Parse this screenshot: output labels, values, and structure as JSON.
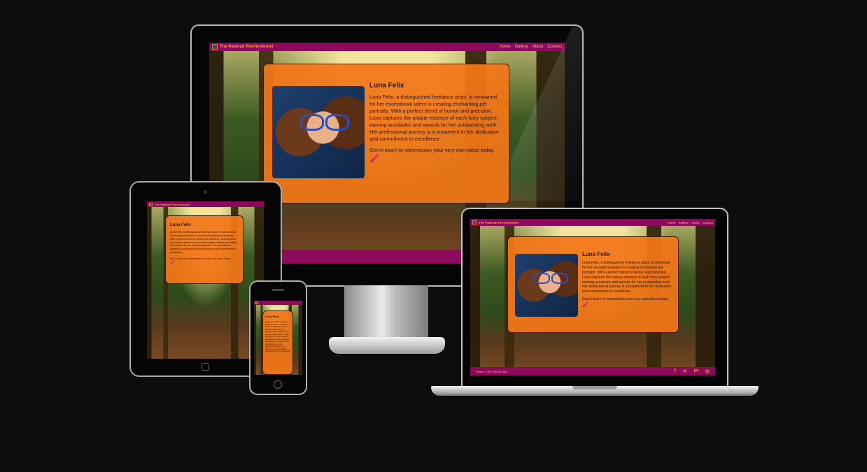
{
  "site": {
    "brand": "The Pawtrait Purrfectionist",
    "nav": [
      "Home",
      "Gallery",
      "About",
      "Contact"
    ],
    "nav_laptop": [
      "Home",
      "Gallery",
      "About",
      "Contact"
    ]
  },
  "about": {
    "heading": "Luna Felix",
    "bio": "Luna Felix, a distinguished freelance artist, is renowned for her exceptional talent in creating enchanting pet portraits. With a perfect blend of humor and precision, Luna captures the unique essence of each furry subject, earning accolades and awards for her outstanding work. Her professional journey is a testament to her dedication and commitment to excellence.",
    "cta": "Get in touch to commission your very own piece today.",
    "cta_icon": "paintbrush-icon"
  },
  "footer": {
    "phone": "Phone: +44 7766 567891",
    "social_icons": [
      "facebook-icon",
      "x-icon",
      "linkedin-icon",
      "instagram-icon"
    ]
  },
  "colors": {
    "navbar": "#8b0a5b",
    "card": "#f37618",
    "accent_text": "#f6a43a",
    "page_bg": "#0d0d0d"
  }
}
